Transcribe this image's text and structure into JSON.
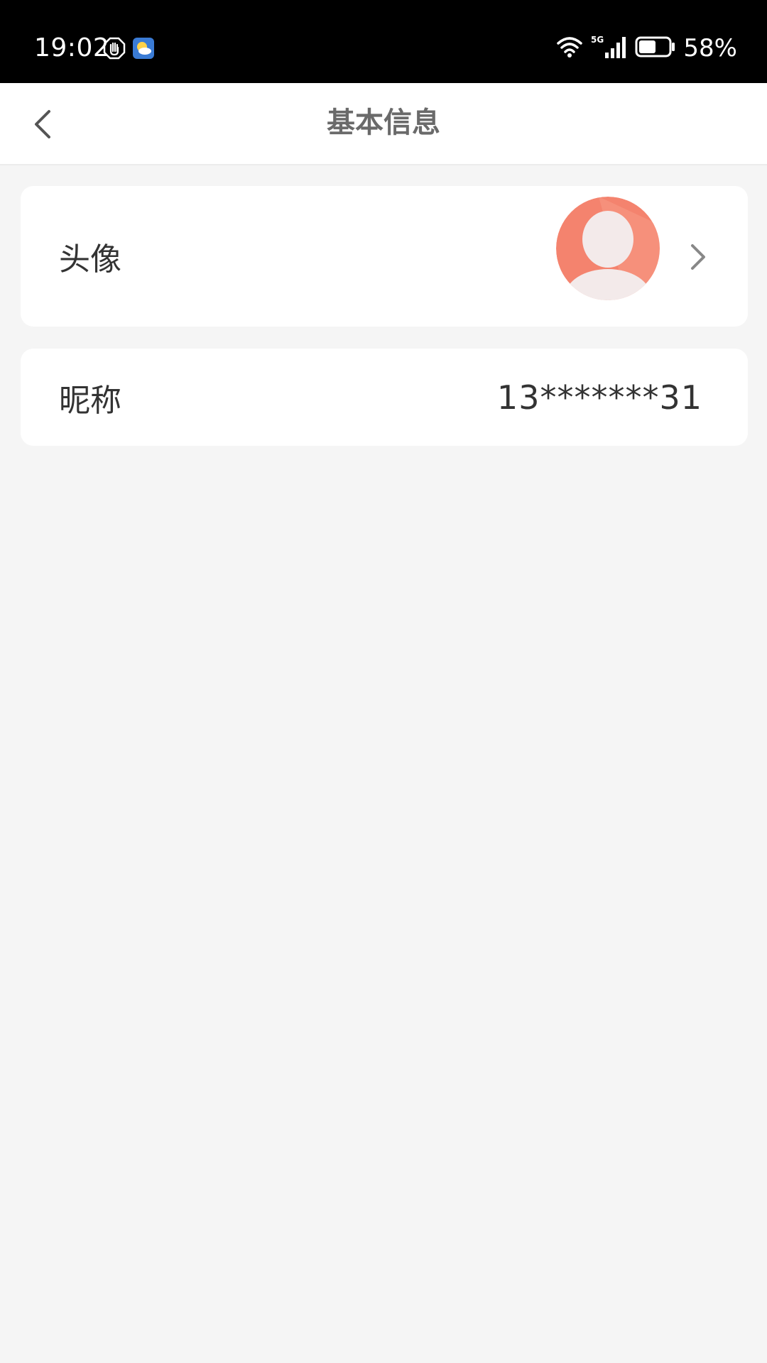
{
  "status_bar": {
    "time": "19:02",
    "battery_percent": "58%",
    "battery_level": 0.58,
    "network": "5G"
  },
  "header": {
    "title": "基本信息"
  },
  "profile": {
    "avatar_label": "头像",
    "nickname_label": "昵称",
    "nickname_value": "13*******31"
  },
  "icons": {
    "back": "back-arrow-icon",
    "chevron": "chevron-right-icon",
    "wifi": "wifi-icon",
    "signal": "signal-icon",
    "battery": "battery-icon"
  },
  "colors": {
    "avatar_bg": "#f4836e",
    "page_bg": "#f5f5f5"
  }
}
